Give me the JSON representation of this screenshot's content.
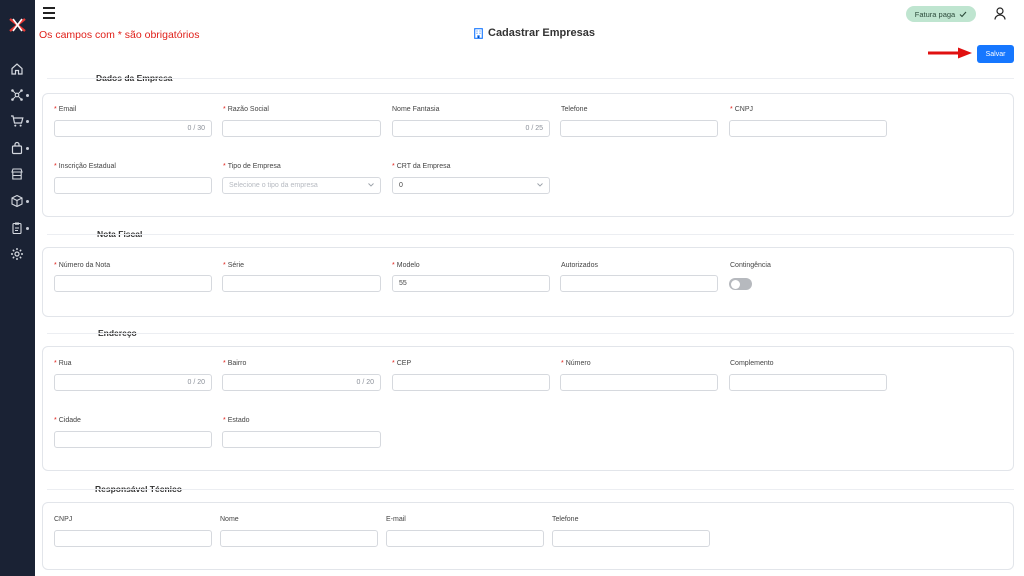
{
  "header": {
    "title": "Cadastrar Empresas",
    "required_note": "Os campos com * são obrigatórios",
    "status_badge": "Fatura paga",
    "save_label": "Salvar"
  },
  "sidebar": {
    "logo": "x-logo",
    "items": [
      {
        "icon": "home-icon",
        "has_submenu": false
      },
      {
        "icon": "network-icon",
        "has_submenu": true
      },
      {
        "icon": "cart-icon",
        "has_submenu": true
      },
      {
        "icon": "bag-icon",
        "has_submenu": true
      },
      {
        "icon": "store-icon",
        "has_submenu": false
      },
      {
        "icon": "box-icon",
        "has_submenu": true
      },
      {
        "icon": "clipboard-icon",
        "has_submenu": true
      },
      {
        "icon": "gear-icon",
        "has_submenu": false
      }
    ]
  },
  "sections": {
    "empresa": {
      "title": "Dados da Empresa",
      "email": {
        "label": "Email",
        "required": true,
        "value": "",
        "counter": "0 / 30"
      },
      "razao_social": {
        "label": "Razão Social",
        "required": true,
        "value": ""
      },
      "nome_fantasia": {
        "label": "Nome Fantasia",
        "required": false,
        "value": "",
        "counter": "0 / 25"
      },
      "telefone": {
        "label": "Telefone",
        "required": false,
        "value": ""
      },
      "cnpj": {
        "label": "CNPJ",
        "required": true,
        "value": ""
      },
      "inscricao_estadual": {
        "label": "Inscrição Estadual",
        "required": true,
        "value": ""
      },
      "tipo_empresa": {
        "label": "Tipo de Empresa",
        "required": true,
        "placeholder": "Selecione o tipo da empresa"
      },
      "crt_empresa": {
        "label": "CRT da Empresa",
        "required": true,
        "value": "0"
      }
    },
    "nota_fiscal": {
      "title": "Nota Fiscal",
      "numero_nota": {
        "label": "Número da Nota",
        "required": true,
        "value": ""
      },
      "serie": {
        "label": "Série",
        "required": true,
        "value": ""
      },
      "modelo": {
        "label": "Modelo",
        "required": true,
        "value": "55"
      },
      "autorizados": {
        "label": "Autorizados",
        "required": false,
        "value": ""
      },
      "contingencia": {
        "label": "Contingência",
        "required": false,
        "enabled": false
      }
    },
    "endereco": {
      "title": "Endereço",
      "rua": {
        "label": "Rua",
        "required": true,
        "value": "",
        "counter": "0 / 20"
      },
      "bairro": {
        "label": "Bairro",
        "required": true,
        "value": "",
        "counter": "0 / 20"
      },
      "cep": {
        "label": "CEP",
        "required": true,
        "value": ""
      },
      "numero": {
        "label": "Número",
        "required": true,
        "value": ""
      },
      "complemento": {
        "label": "Complemento",
        "required": false,
        "value": ""
      },
      "cidade": {
        "label": "Cidade",
        "required": true,
        "value": ""
      },
      "estado": {
        "label": "Estado",
        "required": true,
        "value": ""
      }
    },
    "responsavel": {
      "title": "Responsável Técnico",
      "cnpj": {
        "label": "CNPJ",
        "required": false,
        "value": ""
      },
      "nome": {
        "label": "Nome",
        "required": false,
        "value": ""
      },
      "email": {
        "label": "E-mail",
        "required": false,
        "value": ""
      },
      "telefone": {
        "label": "Telefone",
        "required": false,
        "value": ""
      }
    }
  },
  "colors": {
    "sidebar_bg": "#1a2234",
    "primary": "#1677ff",
    "required": "#e0201a",
    "badge_bg": "#bfe5d0",
    "arrow": "#e01010"
  }
}
